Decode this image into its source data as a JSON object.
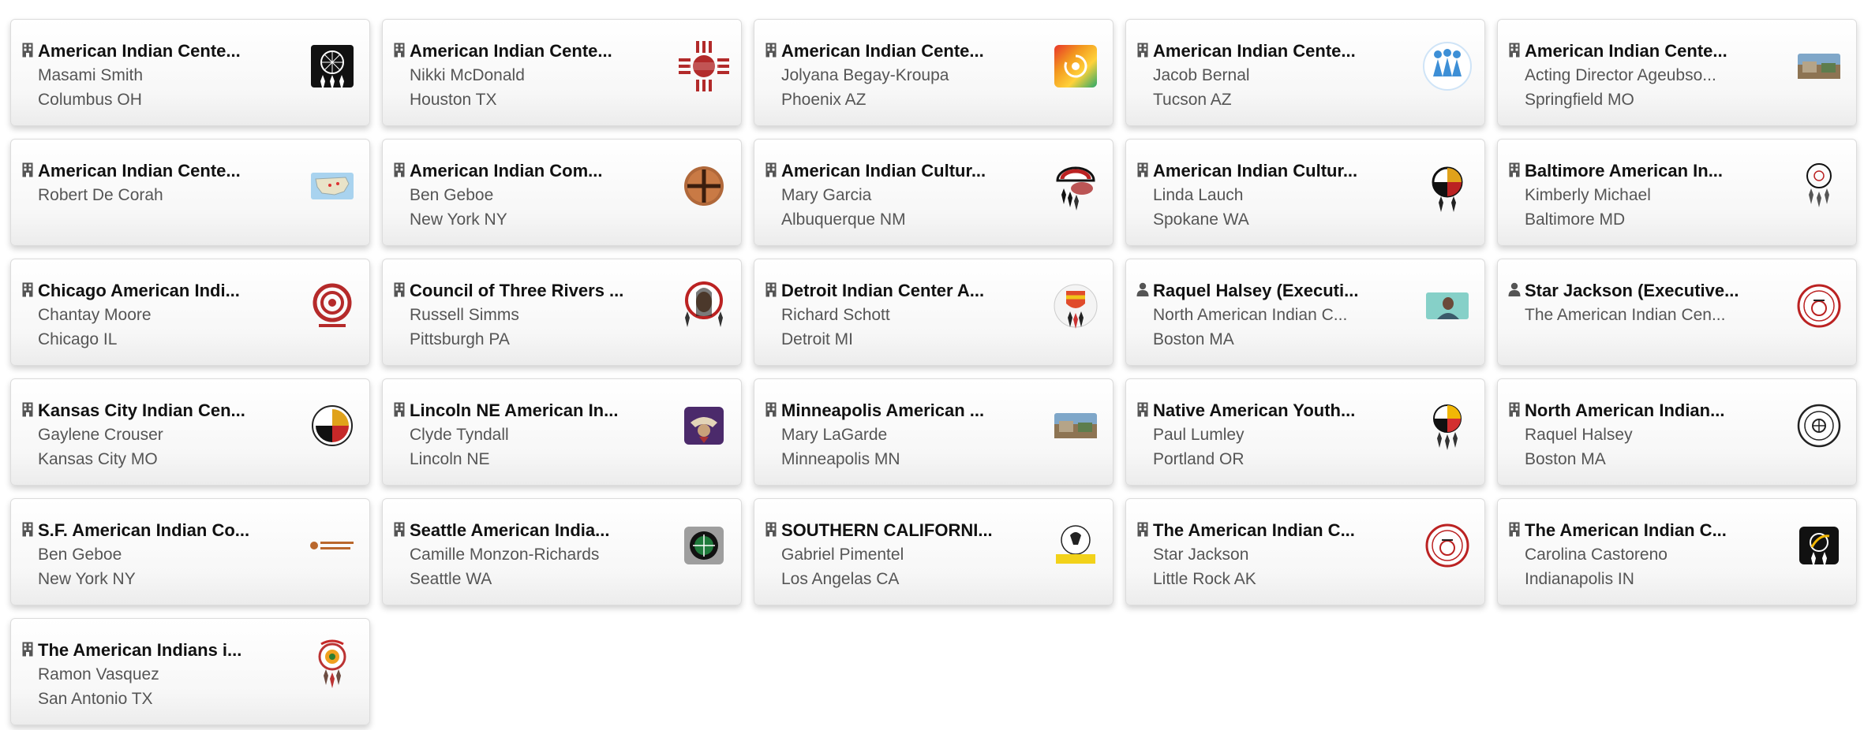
{
  "cards": [
    {
      "type": "organization",
      "kind_icon": "building-icon",
      "title": "American Indian Cente...",
      "line1": "Masami Smith",
      "line2": "Columbus OH",
      "logo": "dreamcatcher-black-logo"
    },
    {
      "type": "organization",
      "kind_icon": "building-icon",
      "title": "American Indian Cente...",
      "line1": "Nikki McDonald",
      "line2": "Houston TX",
      "logo": "zia-sun-red-logo"
    },
    {
      "type": "organization",
      "kind_icon": "building-icon",
      "title": "American Indian Cente...",
      "line1": "Jolyana Begay-Kroupa",
      "line2": "Phoenix AZ",
      "logo": "rainbow-swirl-logo"
    },
    {
      "type": "organization",
      "kind_icon": "building-icon",
      "title": "American Indian Cente...",
      "line1": "Jacob Bernal",
      "line2": "Tucson AZ",
      "logo": "blue-figures-logo"
    },
    {
      "type": "organization",
      "kind_icon": "building-icon",
      "title": "American Indian Cente...",
      "line1": "Acting Director Ageubso...",
      "line2": "Springfield MO",
      "logo": "building-photo-logo"
    },
    {
      "type": "organization",
      "kind_icon": "building-icon",
      "title": "American Indian Cente...",
      "line1": "Robert De Corah",
      "line2": "",
      "logo": "map-logo"
    },
    {
      "type": "organization",
      "kind_icon": "building-icon",
      "title": "American Indian Com...",
      "line1": "Ben Geboe",
      "line2": "New York NY",
      "logo": "medicine-wheel-brown-logo"
    },
    {
      "type": "organization",
      "kind_icon": "building-icon",
      "title": "American Indian Cultur...",
      "line1": "Mary Garcia",
      "line2": "Albuquerque NM",
      "logo": "headdress-feathers-logo"
    },
    {
      "type": "organization",
      "kind_icon": "building-icon",
      "title": "American Indian Cultur...",
      "line1": "Linda Lauch",
      "line2": "Spokane WA",
      "logo": "four-color-wheel-logo"
    },
    {
      "type": "organization",
      "kind_icon": "building-icon",
      "title": "Baltimore American In...",
      "line1": "Kimberly Michael",
      "line2": "Baltimore MD",
      "logo": "dreamcatcher-outline-logo"
    },
    {
      "type": "organization",
      "kind_icon": "building-icon",
      "title": "Chicago American Indi...",
      "line1": "Chantay Moore",
      "line2": "Chicago IL",
      "logo": "red-spiral-logo"
    },
    {
      "type": "organization",
      "kind_icon": "building-icon",
      "title": "Council of Three Rivers ...",
      "line1": "Russell Simms",
      "line2": "Pittsburgh PA",
      "logo": "portrait-circle-logo"
    },
    {
      "type": "organization",
      "kind_icon": "building-icon",
      "title": "Detroit Indian Center A...",
      "line1": "Richard Schott",
      "line2": "Detroit MI",
      "logo": "shield-feathers-logo"
    },
    {
      "type": "person",
      "kind_icon": "person-icon",
      "title": "Raquel Halsey (Executi...",
      "line1": "North American Indian C...",
      "line2": "Boston MA",
      "logo": "person-photo-logo"
    },
    {
      "type": "person",
      "kind_icon": "person-icon",
      "title": "Star Jackson (Executive...",
      "line1": "The American Indian Cen...",
      "line2": "",
      "logo": "aica-circle-logo"
    },
    {
      "type": "organization",
      "kind_icon": "building-icon",
      "title": "Kansas City Indian Cen...",
      "line1": "Gaylene Crouser",
      "line2": "Kansas City MO",
      "logo": "kc-medicine-wheel-logo"
    },
    {
      "type": "organization",
      "kind_icon": "building-icon",
      "title": "Lincoln NE American In...",
      "line1": "Clyde Tyndall",
      "line2": "Lincoln NE",
      "logo": "purple-eagle-logo"
    },
    {
      "type": "organization",
      "kind_icon": "building-icon",
      "title": "Minneapolis American ...",
      "line1": "Mary LaGarde",
      "line2": "Minneapolis MN",
      "logo": "building-photo-logo"
    },
    {
      "type": "organization",
      "kind_icon": "building-icon",
      "title": "Native American Youth...",
      "line1": "Paul Lumley",
      "line2": "Portland OR",
      "logo": "four-color-feathers-logo"
    },
    {
      "type": "organization",
      "kind_icon": "building-icon",
      "title": "North American Indian...",
      "line1": "Raquel Halsey",
      "line2": "Boston MA",
      "logo": "seal-circle-logo"
    },
    {
      "type": "organization",
      "kind_icon": "building-icon",
      "title": "S.F. American Indian Co...",
      "line1": "Ben Geboe",
      "line2": "New York NY",
      "logo": "text-wordmark-logo"
    },
    {
      "type": "organization",
      "kind_icon": "building-icon",
      "title": "Seattle American India...",
      "line1": "Camille Monzon-Richards",
      "line2": "Seattle WA",
      "logo": "green-target-logo"
    },
    {
      "type": "organization",
      "kind_icon": "building-icon",
      "title": "SOUTHERN CALIFORNI...",
      "line1": "Gabriel Pimentel",
      "line2": "Los Angelas CA",
      "logo": "yellow-banner-logo"
    },
    {
      "type": "organization",
      "kind_icon": "building-icon",
      "title": "The American Indian C...",
      "line1": "Star Jackson",
      "line2": "Little Rock AK",
      "logo": "aica-circle-logo"
    },
    {
      "type": "organization",
      "kind_icon": "building-icon",
      "title": "The American Indian C...",
      "line1": "Carolina Castoreno",
      "line2": "Indianapolis IN",
      "logo": "black-feathers-logo"
    },
    {
      "type": "organization",
      "kind_icon": "building-icon",
      "title": "The American Indians i...",
      "line1": "Ramon Vasquez",
      "line2": "San Antonio TX",
      "logo": "colorful-dreamcatcher-logo"
    }
  ]
}
